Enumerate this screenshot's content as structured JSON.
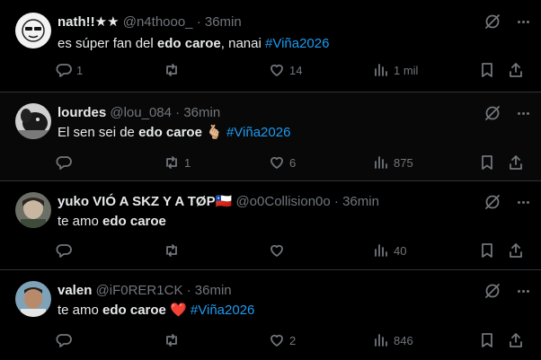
{
  "posts": [
    {
      "name": "nath!!★★",
      "handle": "@n4thooo_",
      "time": "36min",
      "text": [
        {
          "t": "es súper fan del ",
          "s": ""
        },
        {
          "t": "edo caroe",
          "s": "bold"
        },
        {
          "t": ", nanai ",
          "s": ""
        },
        {
          "t": "#Viña2026",
          "s": "tag"
        }
      ],
      "replies": "1",
      "reposts": "",
      "likes": "14",
      "views": "1 mil"
    },
    {
      "name": "lourdes",
      "handle": "@lou_084",
      "time": "36min",
      "text": [
        {
          "t": "El sen sei de ",
          "s": ""
        },
        {
          "t": "edo caroe",
          "s": "bold"
        },
        {
          "t": " 🫰🏼 ",
          "s": ""
        },
        {
          "t": "#Viña2026",
          "s": "tag"
        }
      ],
      "replies": "",
      "reposts": "1",
      "likes": "6",
      "views": "875"
    },
    {
      "name": "yuko VIÓ A SKZ Y A TØP🇨🇱",
      "handle": "@o0Collision0o",
      "time": "36min",
      "text": [
        {
          "t": "te amo ",
          "s": ""
        },
        {
          "t": "edo caroe",
          "s": "bold"
        }
      ],
      "replies": "",
      "reposts": "",
      "likes": "",
      "views": "40"
    },
    {
      "name": "valen",
      "handle": "@iF0RER1CK",
      "time": "36min",
      "text": [
        {
          "t": "te amo ",
          "s": ""
        },
        {
          "t": "edo caroe",
          "s": "bold"
        },
        {
          "t": " ❤️ ",
          "s": ""
        },
        {
          "t": "#Viña2026",
          "s": "tag"
        }
      ],
      "replies": "",
      "reposts": "",
      "likes": "2",
      "views": "846"
    }
  ]
}
